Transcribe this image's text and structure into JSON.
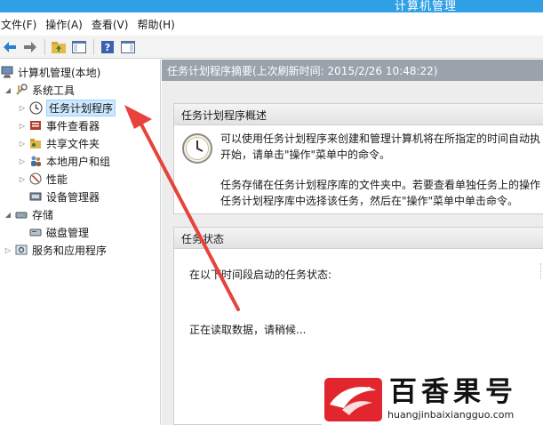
{
  "window": {
    "title": "计算机管理"
  },
  "menu": [
    {
      "label": "文件(F)"
    },
    {
      "label": "操作(A)"
    },
    {
      "label": "查看(V)"
    },
    {
      "label": "帮助(H)"
    }
  ],
  "toolbar": {
    "buttons": [
      "back-arrow-icon",
      "forward-arrow-icon",
      "up-folder-icon",
      "show-hide-tree-icon",
      "help-icon",
      "properties-pane-icon"
    ]
  },
  "tree": {
    "items": [
      {
        "label": "计算机管理(本地)",
        "icon": "computer-management-icon"
      },
      {
        "label": "系统工具",
        "icon": "system-tools-icon"
      },
      {
        "label": "任务计划程序",
        "icon": "clock-icon"
      },
      {
        "label": "事件查看器",
        "icon": "event-viewer-icon"
      },
      {
        "label": "共享文件夹",
        "icon": "shared-folder-icon"
      },
      {
        "label": "本地用户和组",
        "icon": "users-icon"
      },
      {
        "label": "性能",
        "icon": "performance-icon"
      },
      {
        "label": "设备管理器",
        "icon": "device-manager-icon"
      },
      {
        "label": "存储",
        "icon": "storage-icon"
      },
      {
        "label": "磁盘管理",
        "icon": "disk-icon"
      },
      {
        "label": "服务和应用程序",
        "icon": "services-icon"
      }
    ]
  },
  "summary": {
    "header": "任务计划程序摘要(上次刷新时间: 2015/2/26 10:48:22)",
    "overview": {
      "title": "任务计划程序概述",
      "para1_line1": "可以使用任务计划程序来创建和管理计算机将在所指定的时间自动执",
      "para1_line2": "开始，请单击\"操作\"菜单中的命令。",
      "para2_line1": "任务存储在任务计划程序库的文件夹中。若要查看单独任务上的操作",
      "para2_line2": "任务计划程序库中选择该任务，然后在\"操作\"菜单中单击命令。"
    },
    "status": {
      "title": "任务状态",
      "line1": "在以下时间段启动的任务状态:",
      "loading": "正在读取数据，请稍候..."
    }
  },
  "watermark": {
    "text": "百香果号",
    "url": "huangjinbaixiangguo.com"
  },
  "colors": {
    "titlebar": "#2f9fe6",
    "summary_header": "#9aa3ab",
    "arrow": "#e8423a",
    "selection": "#cde8ff"
  }
}
